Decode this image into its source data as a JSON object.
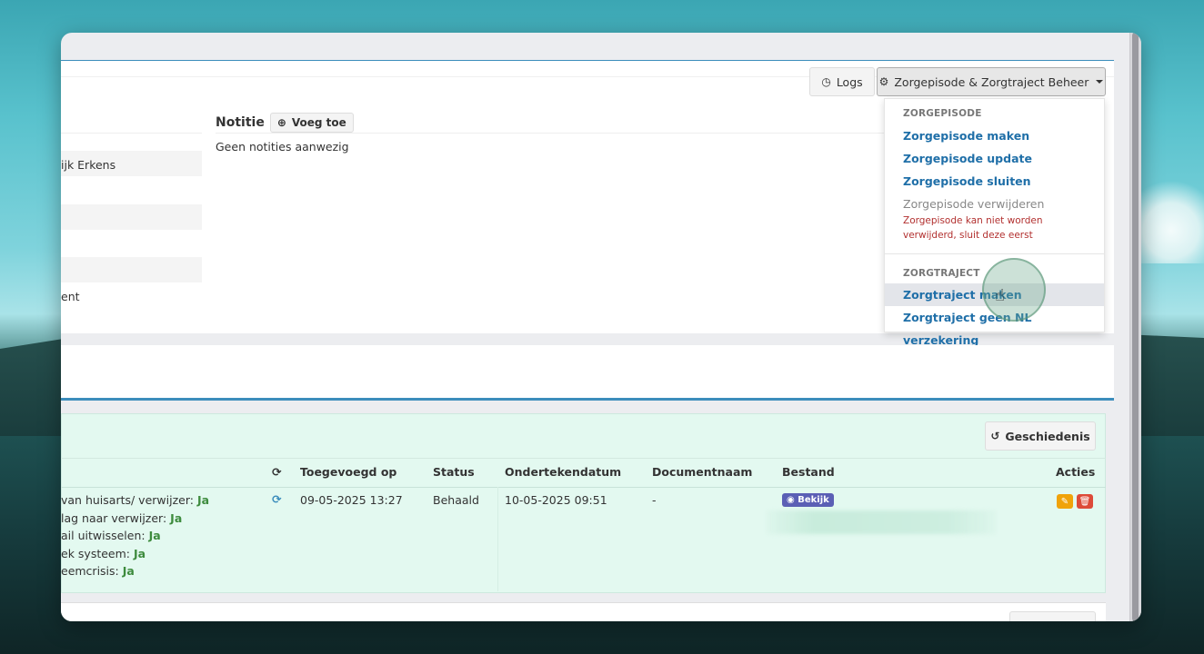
{
  "toolbar": {
    "logs_label": "Logs",
    "beheer_label": "Zorgepisode & Zorgtraject Beheer"
  },
  "left_panel": {
    "name_partial": "ijk Erkens",
    "status_partial": "ent"
  },
  "notes": {
    "title": "Notitie",
    "add_label": "Voeg toe",
    "empty_text": "Geen notities aanwezig"
  },
  "dropdown": {
    "zorgepisode_header": "ZORGEPISODE",
    "items_episode": [
      "Zorgepisode maken",
      "Zorgepisode update",
      "Zorgepisode sluiten"
    ],
    "delete_label": "Zorgepisode verwijderen",
    "delete_warning": "Zorgepisode kan niet worden verwijderd, sluit deze eerst",
    "zorgtraject_header": "ZORGTRAJECT",
    "items_traject": [
      "Zorgtraject maken",
      "Zorgtraject geen NL verzekering"
    ]
  },
  "documents": {
    "history_label": "Geschiedenis",
    "columns": [
      "Toegevoegd op",
      "Status",
      "Ondertekendatum",
      "Documentnaam",
      "Bestand",
      "Acties"
    ],
    "row": {
      "toegevoegd_op": "09-05-2025 13:27",
      "status": "Behaald",
      "ondertekendatum": "10-05-2025 09:51",
      "documentnaam": "-",
      "bestand_label": "Bekijk"
    },
    "consent_lines": [
      {
        "label": "van huisarts/ verwijzer:",
        "value": "Ja"
      },
      {
        "label": "lag naar verwijzer:",
        "value": "Ja"
      },
      {
        "label": "ail uitwisselen:",
        "value": "Ja"
      },
      {
        "label": "ek systeem:",
        "value": "Ja"
      },
      {
        "label": "eemcrisis:",
        "value": "Ja"
      }
    ]
  },
  "colors": {
    "link": "#1f6fa8",
    "warning": "#b2302f",
    "accent": "#3c8dbc",
    "green_panel": "#e3f9f0",
    "ja": "#3d8b3d",
    "edit": "#f0a30a",
    "delete": "#dd4b39",
    "badge": "#5b5fb5"
  }
}
